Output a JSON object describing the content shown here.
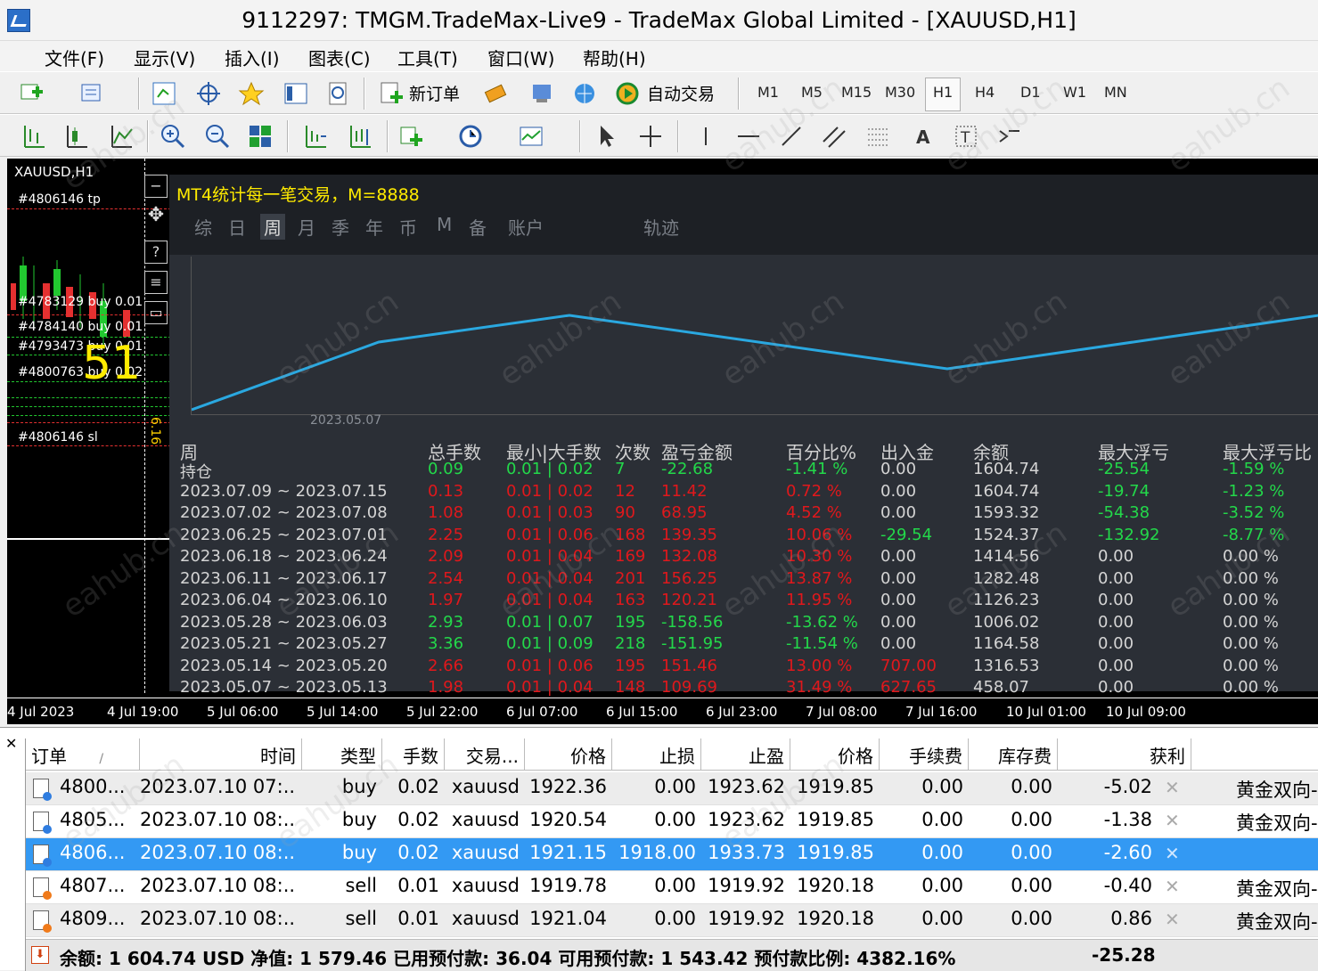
{
  "window": {
    "title": "9112297: TMGM.TradeMax-Live9 - TradeMax Global Limited - [XAUUSD,H1]"
  },
  "menu": [
    "文件(F)",
    "显示(V)",
    "插入(I)",
    "图表(C)",
    "工具(T)",
    "窗口(W)",
    "帮助(H)"
  ],
  "toolbar": {
    "new_order": "新订单",
    "auto_trade": "自动交易",
    "timeframes": [
      "M1",
      "M5",
      "M15",
      "M30",
      "H1",
      "H4",
      "D1",
      "W1",
      "MN"
    ],
    "active_tf": "H1"
  },
  "chart": {
    "symbol_label": "XAUUSD,H1",
    "order_labels": [
      "#4806146 tp",
      "#4783129 buy 0.01",
      "#4784140 buy 0.01",
      "#4793473 buy 0.01",
      "#4800763 buy 0.02",
      "#4806146 sl"
    ],
    "big_number": "51",
    "price_vertical": "6.16",
    "xaxis": [
      "4 Jul 2023",
      "4 Jul 19:00",
      "5 Jul 06:00",
      "5 Jul 14:00",
      "5 Jul 22:00",
      "6 Jul 07:00",
      "6 Jul 15:00",
      "6 Jul 23:00",
      "7 Jul 08:00",
      "7 Jul 16:00",
      "10 Jul 01:00",
      "10 Jul 09:00"
    ]
  },
  "panel": {
    "title": "MT4统计每一笔交易，M=8888",
    "tabs": [
      "综",
      "日",
      "周",
      "月",
      "季",
      "年",
      "币",
      "M",
      "备",
      "账户",
      "轨迹"
    ],
    "selected_tab": "周",
    "graph_date": "2023.05.07",
    "headers": [
      "周",
      "总手数",
      "最小|大手数",
      "次数",
      "盈亏金额",
      "百分比%",
      "出入金",
      "余额",
      "最大浮亏",
      "最大浮亏比"
    ],
    "rows": [
      {
        "period": "持仓",
        "lots": "0.09",
        "minmax": "0.01 | 0.02",
        "count": "7",
        "pnl": "-22.68",
        "pct": "-1.41 %",
        "io": "0.00",
        "balance": "1604.74",
        "maxdd": "-25.54",
        "maxddpct": "-1.59 %",
        "color": "green"
      },
      {
        "period": "2023.07.09 ~ 2023.07.15",
        "lots": "0.13",
        "minmax": "0.01 | 0.02",
        "count": "12",
        "pnl": "11.42",
        "pct": "0.72 %",
        "io": "0.00",
        "balance": "1604.74",
        "maxdd": "-19.74",
        "maxddpct": "-1.23 %",
        "color": "red"
      },
      {
        "period": "2023.07.02 ~ 2023.07.08",
        "lots": "1.08",
        "minmax": "0.01 | 0.03",
        "count": "90",
        "pnl": "68.95",
        "pct": "4.52 %",
        "io": "0.00",
        "balance": "1593.32",
        "maxdd": "-54.38",
        "maxddpct": "-3.52 %",
        "color": "red"
      },
      {
        "period": "2023.06.25 ~ 2023.07.01",
        "lots": "2.25",
        "minmax": "0.01 | 0.06",
        "count": "168",
        "pnl": "139.35",
        "pct": "10.06 %",
        "io": "-29.54",
        "balance": "1524.37",
        "maxdd": "-132.92",
        "maxddpct": "-8.77 %",
        "color": "red"
      },
      {
        "period": "2023.06.18 ~ 2023.06.24",
        "lots": "2.09",
        "minmax": "0.01 | 0.04",
        "count": "169",
        "pnl": "132.08",
        "pct": "10.30 %",
        "io": "0.00",
        "balance": "1414.56",
        "maxdd": "0.00",
        "maxddpct": "0.00 %",
        "color": "red"
      },
      {
        "period": "2023.06.11 ~ 2023.06.17",
        "lots": "2.54",
        "minmax": "0.01 | 0.04",
        "count": "201",
        "pnl": "156.25",
        "pct": "13.87 %",
        "io": "0.00",
        "balance": "1282.48",
        "maxdd": "0.00",
        "maxddpct": "0.00 %",
        "color": "red"
      },
      {
        "period": "2023.06.04 ~ 2023.06.10",
        "lots": "1.97",
        "minmax": "0.01 | 0.04",
        "count": "163",
        "pnl": "120.21",
        "pct": "11.95 %",
        "io": "0.00",
        "balance": "1126.23",
        "maxdd": "0.00",
        "maxddpct": "0.00 %",
        "color": "red"
      },
      {
        "period": "2023.05.28 ~ 2023.06.03",
        "lots": "2.93",
        "minmax": "0.01 | 0.07",
        "count": "195",
        "pnl": "-158.56",
        "pct": "-13.62 %",
        "io": "0.00",
        "balance": "1006.02",
        "maxdd": "0.00",
        "maxddpct": "0.00 %",
        "color": "green"
      },
      {
        "period": "2023.05.21 ~ 2023.05.27",
        "lots": "3.36",
        "minmax": "0.01 | 0.09",
        "count": "218",
        "pnl": "-151.95",
        "pct": "-11.54 %",
        "io": "0.00",
        "balance": "1164.58",
        "maxdd": "0.00",
        "maxddpct": "0.00 %",
        "color": "green"
      },
      {
        "period": "2023.05.14 ~ 2023.05.20",
        "lots": "2.66",
        "minmax": "0.01 | 0.06",
        "count": "195",
        "pnl": "151.46",
        "pct": "13.00 %",
        "io": "707.00",
        "balance": "1316.53",
        "maxdd": "0.00",
        "maxddpct": "0.00 %",
        "color": "red"
      },
      {
        "period": "2023.05.07 ~ 2023.05.13",
        "lots": "1.98",
        "minmax": "0.01 | 0.04",
        "count": "148",
        "pnl": "109.69",
        "pct": "31.49 %",
        "io": "627.65",
        "balance": "458.07",
        "maxdd": "0.00",
        "maxddpct": "0.00 %",
        "color": "red"
      }
    ]
  },
  "terminal": {
    "headers": [
      "订单",
      "/",
      "时间",
      "类型",
      "手数",
      "交易...",
      "价格",
      "止损",
      "止盈",
      "价格",
      "手续费",
      "库存费",
      "获利"
    ],
    "rows": [
      {
        "order": "4800...",
        "time": "2023.07.10 07:...",
        "type": "buy",
        "lots": "0.02",
        "symbol": "xauusd",
        "price": "1922.36",
        "sl": "0.00",
        "tp": "1923.62",
        "cur": "1919.85",
        "comm": "0.00",
        "swap": "0.00",
        "profit": "-5.02",
        "comment": "黄金双向-"
      },
      {
        "order": "4805...",
        "time": "2023.07.10 08:...",
        "type": "buy",
        "lots": "0.02",
        "symbol": "xauusd",
        "price": "1920.54",
        "sl": "0.00",
        "tp": "1923.62",
        "cur": "1919.85",
        "comm": "0.00",
        "swap": "0.00",
        "profit": "-1.38",
        "comment": "黄金双向-"
      },
      {
        "order": "4806...",
        "time": "2023.07.10 08:...",
        "type": "buy",
        "lots": "0.02",
        "symbol": "xauusd",
        "price": "1921.15",
        "sl": "1918.00",
        "tp": "1933.73",
        "cur": "1919.85",
        "comm": "0.00",
        "swap": "0.00",
        "profit": "-2.60",
        "comment": ""
      },
      {
        "order": "4807...",
        "time": "2023.07.10 08:...",
        "type": "sell",
        "lots": "0.01",
        "symbol": "xauusd",
        "price": "1919.78",
        "sl": "0.00",
        "tp": "1919.92",
        "cur": "1920.18",
        "comm": "0.00",
        "swap": "0.00",
        "profit": "-0.40",
        "comment": "黄金双向-"
      },
      {
        "order": "4809...",
        "time": "2023.07.10 08:...",
        "type": "sell",
        "lots": "0.01",
        "symbol": "xauusd",
        "price": "1921.04",
        "sl": "0.00",
        "tp": "1919.92",
        "cur": "1920.18",
        "comm": "0.00",
        "swap": "0.00",
        "profit": "0.86",
        "comment": "黄金双向-"
      }
    ],
    "summary": "余额: 1 604.74 USD  净值: 1 579.46  已用预付款: 36.04  可用预付款: 1 543.42  预付款比例: 4382.16%",
    "total_profit": "-25.28"
  },
  "watermark": "eahub.cn"
}
